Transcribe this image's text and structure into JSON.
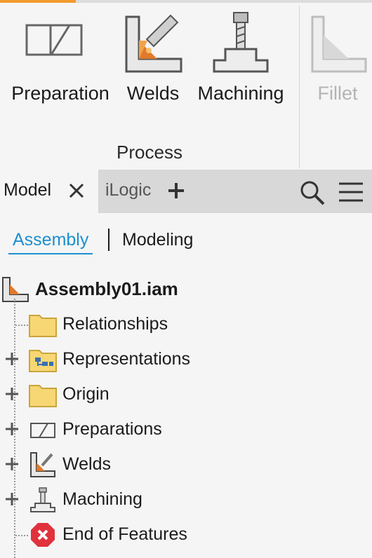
{
  "ribbon": {
    "buttons": [
      {
        "label": "Preparation",
        "icon": "preparation-icon"
      },
      {
        "label": "Welds",
        "icon": "welds-icon"
      },
      {
        "label": "Machining",
        "icon": "machining-icon"
      },
      {
        "label": "Fillet",
        "icon": "fillet-icon",
        "disabled": true
      }
    ],
    "panel_title": "Process"
  },
  "browser": {
    "tabs": [
      {
        "label": "Model",
        "active": true
      },
      {
        "label": "iLogic",
        "active": false
      }
    ],
    "subtabs": [
      {
        "label": "Assembly",
        "active": true
      },
      {
        "label": "Modeling",
        "active": false
      }
    ]
  },
  "tree": {
    "root": {
      "label": "Assembly01.iam",
      "icon": "assembly-icon"
    },
    "nodes": [
      {
        "label": "Relationships",
        "icon": "folder-icon",
        "expandable": false
      },
      {
        "label": "Representations",
        "icon": "representations-folder-icon",
        "expandable": true
      },
      {
        "label": "Origin",
        "icon": "folder-icon",
        "expandable": true
      },
      {
        "label": "Preparations",
        "icon": "preparation-icon",
        "expandable": true
      },
      {
        "label": "Welds",
        "icon": "welds-icon",
        "expandable": true
      },
      {
        "label": "Machining",
        "icon": "machining-icon",
        "expandable": true
      },
      {
        "label": "End of Features",
        "icon": "end-of-features-icon",
        "expandable": false
      }
    ]
  },
  "colors": {
    "accent": "#f29a2e",
    "link": "#1e8fcf",
    "folder": "#f7d774",
    "error": "#e0323c"
  }
}
